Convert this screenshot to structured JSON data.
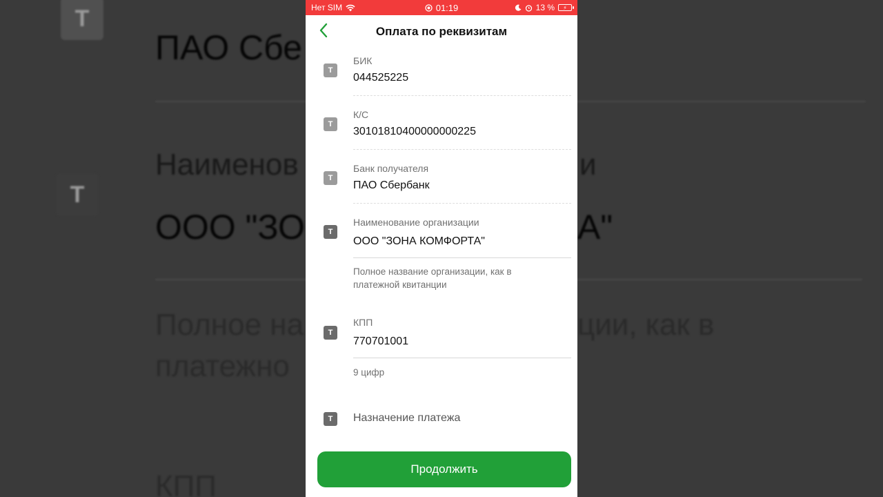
{
  "status_bar": {
    "carrier": "Нет SIM",
    "time": "01:19",
    "battery": "13 %"
  },
  "nav": {
    "title": "Оплата по реквизитам",
    "back_icon": "chevron-left-icon"
  },
  "fields": [
    {
      "label": "БИК",
      "value": "044525225",
      "icon": "text-field-icon"
    },
    {
      "label": "К/С",
      "value": "30101810400000000225",
      "icon": "text-field-icon"
    },
    {
      "label": "Банк получателя",
      "value": "ПАО Сбербанк",
      "icon": "text-field-icon"
    },
    {
      "label": "Наименование организации",
      "value": "ООО \"ЗОНА КОМФОРТА\"",
      "hint": "Полное название организации, как в платежной квитанции",
      "icon": "text-field-icon"
    },
    {
      "label": "КПП",
      "value": "770701001",
      "hint": "9 цифр",
      "icon": "text-field-icon"
    },
    {
      "placeholder": "Назначение платежа",
      "icon": "text-field-icon"
    }
  ],
  "icon_glyph": "Т",
  "continue_label": "Продолжить",
  "background": {
    "texts": [
      "ПАО Сбе",
      "Наименов",
      "и",
      "ООО \"ЗО",
      "А\"",
      "Полное на",
      "ции, как в",
      "платежно",
      "КПП"
    ]
  },
  "colors": {
    "accent_green": "#21a038",
    "status_red": "#f23b3b"
  }
}
